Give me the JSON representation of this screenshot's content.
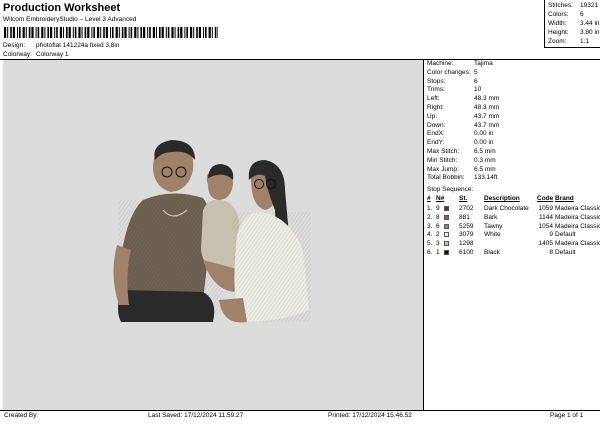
{
  "header": {
    "title": "Production Worksheet",
    "subtitle": "Wilcom EmbroideryStudio – Level 3 Advanced",
    "design_label": "Design:",
    "design_value": "photoflat 141224a fixed 3,8in",
    "colorway_label": "Colorway:",
    "colorway_value": "Colorway 1"
  },
  "stats": {
    "stitches_label": "Stitches:",
    "stitches_value": "19321",
    "colors_label": "Colors:",
    "colors_value": "6",
    "width_label": "Width:",
    "width_value": "3.44 in",
    "height_label": "Height:",
    "height_value": "3.80 in",
    "zoom_label": "Zoom:",
    "zoom_value": "1:1"
  },
  "machine_info": [
    {
      "label": "Machine:",
      "value": "Tajima"
    },
    {
      "label": "Color changes:",
      "value": "5"
    },
    {
      "label": "Stops:",
      "value": "6"
    },
    {
      "label": "Trims:",
      "value": "10"
    },
    {
      "label": "Left:",
      "value": "48.3 mm"
    },
    {
      "label": "Right:",
      "value": "48.3 mm"
    },
    {
      "label": "Up:",
      "value": "43.7 mm"
    },
    {
      "label": "Down:",
      "value": "43.7 mm"
    },
    {
      "label": "EndX:",
      "value": "0.00 in"
    },
    {
      "label": "EndY:",
      "value": "0.00 in"
    },
    {
      "label": "Max Stitch:",
      "value": "6.5 mm"
    },
    {
      "label": "Min Stitch:",
      "value": "0.3 mm"
    },
    {
      "label": "Max Jump:",
      "value": "6.5 mm"
    },
    {
      "label": "Total Bobbin:",
      "value": "133.14ft"
    }
  ],
  "sequence": {
    "title": "Stop Sequence:",
    "headers": {
      "num": "#",
      "n": "N#",
      "st": "St.",
      "description": "Description",
      "code": "Code",
      "brand": "Brand"
    },
    "rows": [
      {
        "num": "1.",
        "n": "9",
        "color": "#5a3a22",
        "st": "2702",
        "description": "Dark Chocolate",
        "code": "1059",
        "brand": "Madeira Classic 40"
      },
      {
        "num": "2.",
        "n": "8",
        "color": "#7a6a55",
        "st": "881",
        "description": "Bark",
        "code": "1144",
        "brand": "Madeira Classic 40"
      },
      {
        "num": "3.",
        "n": "6",
        "color": "#a0826a",
        "st": "5259",
        "description": "Tawny",
        "code": "1054",
        "brand": "Madeira Classic 40"
      },
      {
        "num": "4.",
        "n": "2",
        "color": "#f2f2ec",
        "st": "3079",
        "description": "White",
        "code": "9",
        "brand": "Default"
      },
      {
        "num": "5.",
        "n": "3",
        "color": "#c9c1b0",
        "st": "1298",
        "description": "",
        "code": "1405",
        "brand": "Madeira Classic 40"
      },
      {
        "num": "6.",
        "n": "1",
        "color": "#111111",
        "st": "6100",
        "description": "Black",
        "code": "8",
        "brand": "Default"
      }
    ]
  },
  "footer": {
    "created_by": "Created By:",
    "last_saved": "Last Saved: 17/12/2024 11.59.27",
    "printed": "Printed: 17/12/2024 15.46.52",
    "page": "Page 1 of 1"
  },
  "colors": {
    "canvas_bg": "#dcdcdc",
    "skin": "#a0826a",
    "hair": "#2a2a2a",
    "shirt": "#6f6152",
    "cardigan": "#ecece4"
  }
}
